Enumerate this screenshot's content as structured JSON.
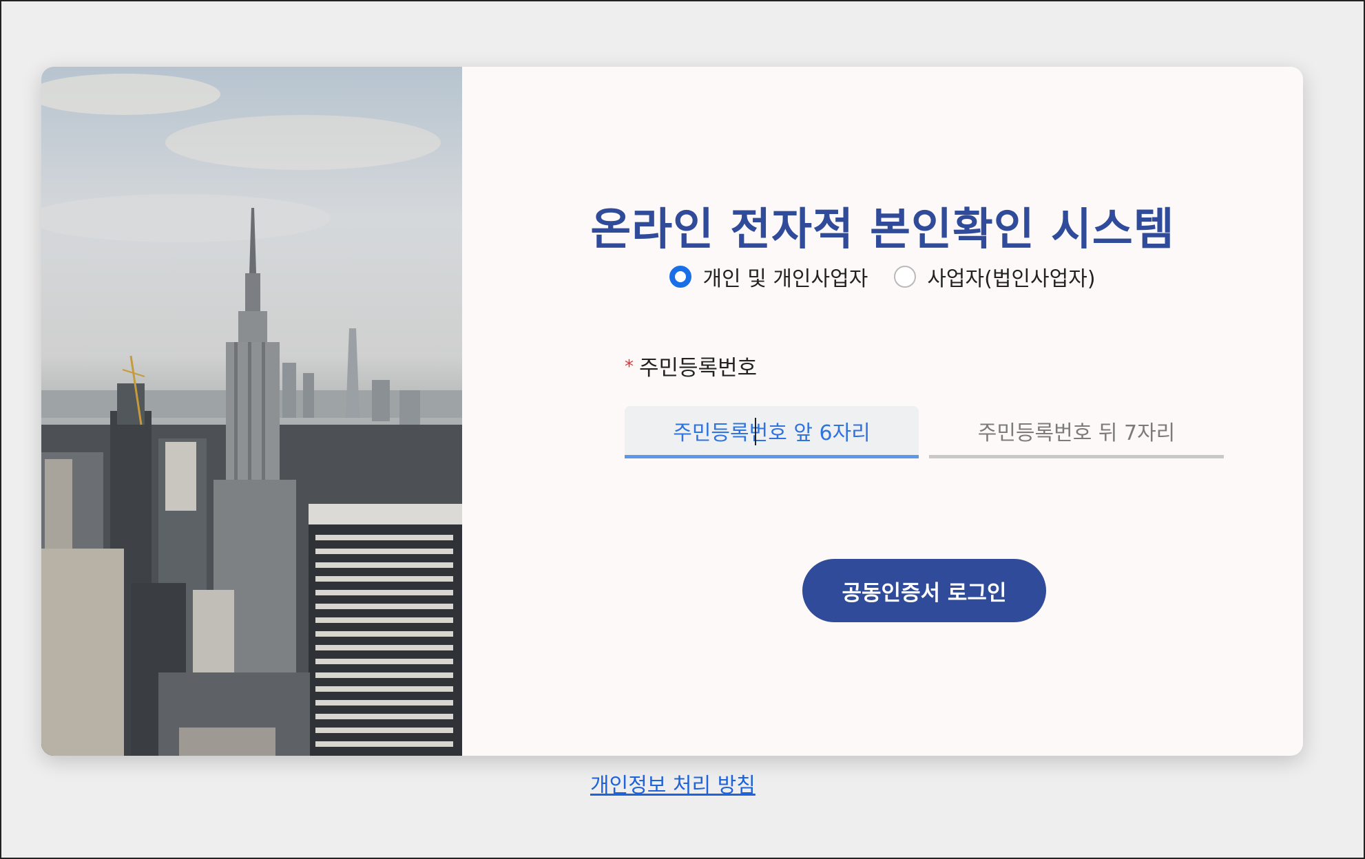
{
  "title": "온라인 전자적 본인확인 시스템",
  "user_type": {
    "options": [
      {
        "label": "개인 및 개인사업자",
        "selected": true
      },
      {
        "label": "사업자(법인사업자)",
        "selected": false
      }
    ]
  },
  "rrn": {
    "label": "주민등록번호",
    "required_mark": "*",
    "front_placeholder": "주민등록번호 앞 6자리",
    "back_placeholder": "주민등록번호 뒤 7자리"
  },
  "login_button": "공동인증서 로그인",
  "privacy_link": "개인정보 처리 방침",
  "colors": {
    "brand": "#2f4b99",
    "accent": "#1a6ee6",
    "link": "#1e63d9",
    "required": "#d83a3a"
  }
}
